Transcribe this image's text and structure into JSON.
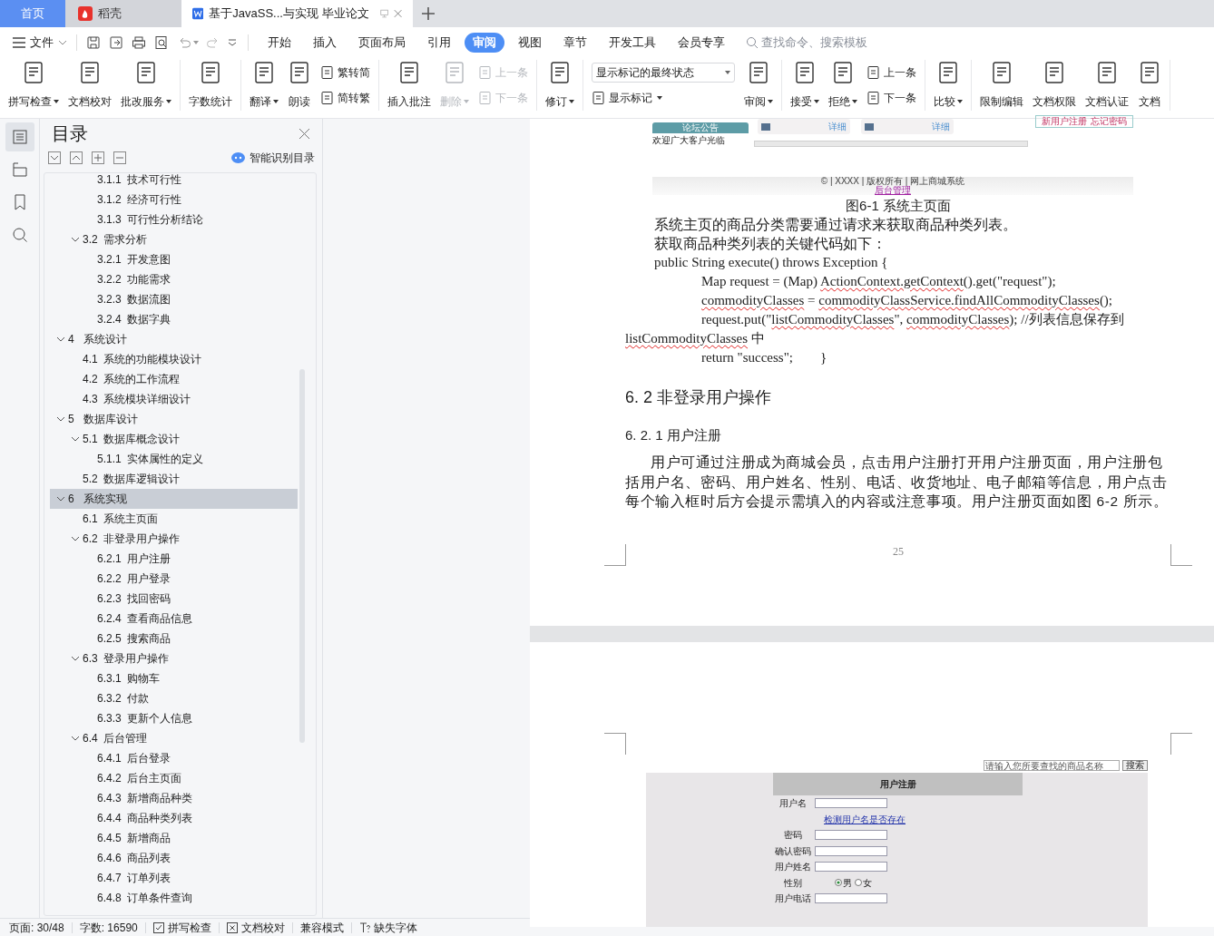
{
  "tabs": [
    {
      "label": "首页",
      "kind": "home",
      "selected": false
    },
    {
      "label": "稻壳",
      "kind": "docer",
      "selected": false
    },
    {
      "label": "基于JavaSS...与实现 毕业论文",
      "kind": "document",
      "selected": true
    }
  ],
  "menu": {
    "file": "文件"
  },
  "ribbon_tabs": [
    {
      "label": "开始",
      "selected": false
    },
    {
      "label": "插入",
      "selected": false
    },
    {
      "label": "页面布局",
      "selected": false
    },
    {
      "label": "引用",
      "selected": false
    },
    {
      "label": "审阅",
      "selected": true
    },
    {
      "label": "视图",
      "selected": false
    },
    {
      "label": "章节",
      "selected": false
    },
    {
      "label": "开发工具",
      "selected": false
    },
    {
      "label": "会员专享",
      "selected": false
    }
  ],
  "search": {
    "placeholder": "查找命令、搜索模板"
  },
  "toolbar": [
    {
      "items": [
        {
          "kind": "large",
          "label": "拼写检查",
          "dropdown": true,
          "disabled": false
        },
        {
          "kind": "large",
          "label": "文档校对",
          "dropdown": false,
          "disabled": false
        },
        {
          "kind": "large",
          "label": "批改服务",
          "dropdown": true,
          "disabled": false
        }
      ]
    },
    {
      "items": [
        {
          "kind": "large",
          "label": "字数统计",
          "dropdown": false,
          "disabled": false
        }
      ]
    },
    {
      "items": [
        {
          "kind": "large",
          "label": "翻译",
          "dropdown": true,
          "disabled": false
        },
        {
          "kind": "large",
          "label": "朗读",
          "dropdown": false,
          "disabled": false
        },
        {
          "kind": "stack",
          "items": [
            {
              "label": "繁转简",
              "dropdown": false,
              "disabled": false
            },
            {
              "label": "简转繁",
              "dropdown": false,
              "disabled": false
            }
          ]
        }
      ]
    },
    {
      "items": [
        {
          "kind": "large",
          "label": "插入批注",
          "dropdown": false,
          "disabled": false
        },
        {
          "kind": "large",
          "label": "删除",
          "dropdown": true,
          "disabled": true
        },
        {
          "kind": "stack",
          "items": [
            {
              "label": "上一条",
              "dropdown": false,
              "disabled": true
            },
            {
              "label": "下一条",
              "dropdown": false,
              "disabled": true
            }
          ]
        }
      ]
    },
    {
      "items": [
        {
          "kind": "large",
          "label": "修订",
          "dropdown": true,
          "disabled": false
        }
      ]
    },
    {
      "items": [
        {
          "kind": "select_stack",
          "value": "显示标记的最终状态",
          "item": {
            "label": "显示标记",
            "dropdown": true,
            "disabled": false
          }
        },
        {
          "kind": "large",
          "label": "审阅",
          "dropdown": true,
          "disabled": false
        }
      ]
    },
    {
      "items": [
        {
          "kind": "large",
          "label": "接受",
          "dropdown": true,
          "disabled": false
        },
        {
          "kind": "large",
          "label": "拒绝",
          "dropdown": true,
          "disabled": false
        },
        {
          "kind": "stack",
          "items": [
            {
              "label": "上一条",
              "dropdown": false,
              "disabled": false
            },
            {
              "label": "下一条",
              "dropdown": false,
              "disabled": false
            }
          ]
        }
      ]
    },
    {
      "items": [
        {
          "kind": "large",
          "label": "比较",
          "dropdown": true,
          "disabled": false
        }
      ]
    },
    {
      "items": [
        {
          "kind": "large",
          "label": "限制编辑",
          "dropdown": false,
          "disabled": false
        },
        {
          "kind": "large",
          "label": "文档权限",
          "dropdown": false,
          "disabled": false
        },
        {
          "kind": "large",
          "label": "文档认证",
          "dropdown": false,
          "disabled": false
        },
        {
          "kind": "large",
          "label": "文档",
          "dropdown": false,
          "disabled": false
        }
      ]
    }
  ],
  "rail": [
    {
      "selected": true
    },
    {
      "selected": false
    },
    {
      "selected": false
    },
    {
      "selected": false
    }
  ],
  "nav_panel": {
    "title": "目录",
    "smart_toc": "智能识别目录",
    "toc": [
      {
        "children": [
          {
            "children": [
              {
                "label": "3.1.1  技术可行性",
                "selected": false
              },
              {
                "label": "3.1.2  经济可行性",
                "selected": false
              },
              {
                "label": "3.1.3  可行性分析结论",
                "selected": false
              }
            ]
          },
          {
            "label": "3.2  需求分析",
            "expanded": true,
            "selected": false,
            "children": [
              {
                "label": "3.2.1  开发意图",
                "selected": false
              },
              {
                "label": "3.2.2  功能需求",
                "selected": false
              },
              {
                "label": "3.2.3  数据流图",
                "selected": false
              },
              {
                "label": "3.2.4  数据字典",
                "selected": false
              }
            ]
          }
        ]
      },
      {
        "label": "4   系统设计",
        "expanded": true,
        "selected": false,
        "children": [
          {
            "label": "4.1  系统的功能模块设计",
            "selected": false
          },
          {
            "label": "4.2  系统的工作流程",
            "selected": false
          },
          {
            "label": "4.3  系统模块详细设计",
            "selected": false
          }
        ]
      },
      {
        "label": "5   数据库设计",
        "expanded": true,
        "selected": false,
        "children": [
          {
            "label": "5.1  数据库概念设计",
            "expanded": true,
            "selected": false,
            "children": [
              {
                "label": "5.1.1  实体属性的定义",
                "selected": false
              }
            ]
          },
          {
            "label": "5.2  数据库逻辑设计",
            "selected": false
          }
        ]
      },
      {
        "label": "6   系统实现",
        "expanded": true,
        "selected": true,
        "children": [
          {
            "label": "6.1  系统主页面",
            "selected": false
          },
          {
            "label": "6.2  非登录用户操作",
            "expanded": true,
            "selected": false,
            "children": [
              {
                "label": "6.2.1  用户注册",
                "selected": false
              },
              {
                "label": "6.2.2  用户登录",
                "selected": false
              },
              {
                "label": "6.2.3  找回密码",
                "selected": false
              },
              {
                "label": "6.2.4  查看商品信息",
                "selected": false
              },
              {
                "label": "6.2.5  搜索商品",
                "selected": false
              }
            ]
          },
          {
            "label": "6.3  登录用户操作",
            "expanded": true,
            "selected": false,
            "children": [
              {
                "label": "6.3.1  购物车",
                "selected": false
              },
              {
                "label": "6.3.2  付款",
                "selected": false
              },
              {
                "label": "6.3.3  更新个人信息",
                "selected": false
              }
            ]
          },
          {
            "label": "6.4  后台管理",
            "expanded": true,
            "selected": false,
            "children": [
              {
                "label": "6.4.1  后台登录",
                "selected": false
              },
              {
                "label": "6.4.2  后台主页面",
                "selected": false
              },
              {
                "label": "6.4.3  新增商品种类",
                "selected": false
              },
              {
                "label": "6.4.4  商品种类列表",
                "selected": false
              },
              {
                "label": "6.4.5  新增商品",
                "selected": false
              },
              {
                "label": "6.4.6  商品列表",
                "selected": false
              },
              {
                "label": "6.4.7  订单列表",
                "selected": false
              },
              {
                "label": "6.4.8  订单条件查询",
                "selected": false
              }
            ]
          }
        ]
      }
    ]
  },
  "document": {
    "page1": {
      "figure": {
        "notice_tab": "论坛公告",
        "notice_text": "欢迎广大客户光临",
        "card_links": [
          "详细",
          "详细"
        ],
        "account_links": [
          "新用户注册",
          "忘记密码"
        ],
        "footer": "© | XXXX | 版权所有 | 网上商城系统",
        "admin_link": "后台管理"
      },
      "caption": "图6-1  系统主页面",
      "paragraphs": [
        "系统主页的商品分类需要通过请求来获取商品种类列表。",
        "获取商品种类列表的关键代码如下："
      ],
      "code": [
        {
          "kind": "statement",
          "segments": [
            {
              "text": "public String execute() throws Exception {",
              "flagged": false
            }
          ]
        },
        {
          "kind": "body",
          "segments": [
            {
              "text": "Map request = (Map) ",
              "flagged": false
            },
            {
              "text": "ActionContext.getContext",
              "flagged": true
            },
            {
              "text": "().get(\"request\");",
              "flagged": false
            }
          ]
        },
        {
          "kind": "body",
          "segments": [
            {
              "text": "commodityClasses",
              "flagged": true
            },
            {
              "text": " = ",
              "flagged": false
            },
            {
              "text": "commodityClassService.findAllCommodityClasses",
              "flagged": true
            },
            {
              "text": "();",
              "flagged": false
            }
          ]
        },
        {
          "kind": "body",
          "segments": [
            {
              "text": "request.put(\"",
              "flagged": false
            },
            {
              "text": "listCommodityClasses",
              "flagged": true
            },
            {
              "text": "\", ",
              "flagged": false
            },
            {
              "text": "commodityClasses",
              "flagged": true
            },
            {
              "text": "); //列表信息保存到",
              "flagged": false
            }
          ]
        },
        {
          "kind": "wrap",
          "segments": [
            {
              "text": "listCommodityClasses",
              "flagged": true
            },
            {
              "text": " 中",
              "flagged": false
            }
          ]
        },
        {
          "kind": "body",
          "segments": [
            {
              "text": "return \"success\";        }",
              "flagged": false
            }
          ]
        }
      ],
      "heading": "6. 2  非登录用户操作",
      "subheading": "6. 2. 1  用户注册",
      "body": "用户可通过注册成为商城会员，点击用户注册打开用户注册页面，用户注册包括用户名、密码、用户姓名、性别、电话、收货地址、电子邮箱等信息，用户点击每个输入框时后方会提示需填入的内容或注意事项。用户注册页面如图 6-2 所示。",
      "page_number": "25"
    },
    "page2": {
      "figure": {
        "search_placeholder": "请输入您所要查找的商品名称",
        "search_button": "搜索",
        "form_title": "用户注册",
        "fields": [
          {
            "kind": "input",
            "label": "用户名"
          },
          {
            "kind": "link",
            "label": "检测用户名是否存在"
          },
          {
            "kind": "input",
            "label": "密码"
          },
          {
            "kind": "input",
            "label": "确认密码"
          },
          {
            "kind": "input",
            "label": "用户姓名"
          },
          {
            "kind": "radio",
            "label": "性别",
            "options": [
              {
                "label": "男",
                "selected": true
              },
              {
                "label": "女",
                "selected": false
              }
            ]
          },
          {
            "kind": "input",
            "label": "用户电话"
          }
        ]
      }
    }
  },
  "status_bar": [
    {
      "kind": "text",
      "label": "页面: 30/48"
    },
    {
      "kind": "text",
      "label": "字数: 16590"
    },
    {
      "kind": "check",
      "label": "拼写检查"
    },
    {
      "kind": "cross",
      "label": "文档校对"
    },
    {
      "kind": "text",
      "label": "兼容模式"
    },
    {
      "kind": "font",
      "label": "缺失字体"
    }
  ]
}
